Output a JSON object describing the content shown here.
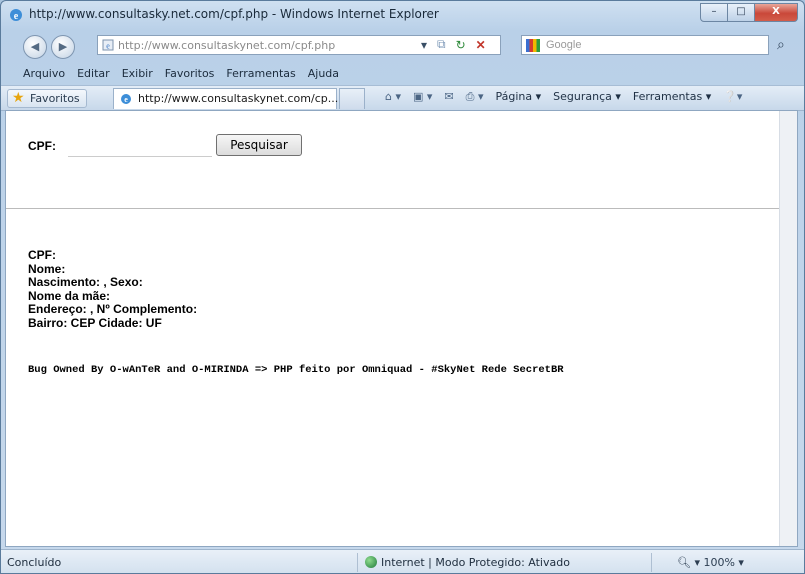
{
  "window": {
    "title": "http://www.consultasky.net.com/cpf.php - Windows Internet Explorer",
    "buttons": {
      "minimize": "–",
      "maximize": "□",
      "close": "X"
    }
  },
  "nav": {
    "address": "http://www.consultaskynet.com/cpf.php",
    "address_domain": "consultaskynet.com",
    "search_placeholder": "Google"
  },
  "menu": [
    "Arquivo",
    "Editar",
    "Exibir",
    "Favoritos",
    "Ferramentas",
    "Ajuda"
  ],
  "favorites": {
    "button_label": "Favoritos",
    "tab_label": "http://www.consultaskynet.com/cp...",
    "commands": [
      "Página ▾",
      "Segurança ▾",
      "Ferramentas ▾"
    ]
  },
  "form": {
    "cpf_label": "CPF:",
    "cpf_value": "",
    "search_button": "Pesquisar"
  },
  "fields": [
    "CPF:",
    "Nome:",
    "Nascimento: , Sexo:",
    "Nome da mãe:",
    "Endereço: , Nº Complemento:",
    "Bairro: CEP  Cidade:  UF"
  ],
  "credits": "Bug Owned By O-wAnTeR and O-MIRINDA => PHP feito por  Omniquad  - #SkyNet Rede SecretBR",
  "status": {
    "left": "Concluído",
    "zone": "Internet | Modo Protegido: Ativado",
    "zoom": "100%"
  },
  "colors": {
    "accent": "#3a6fd1",
    "close": "#c9483a"
  }
}
